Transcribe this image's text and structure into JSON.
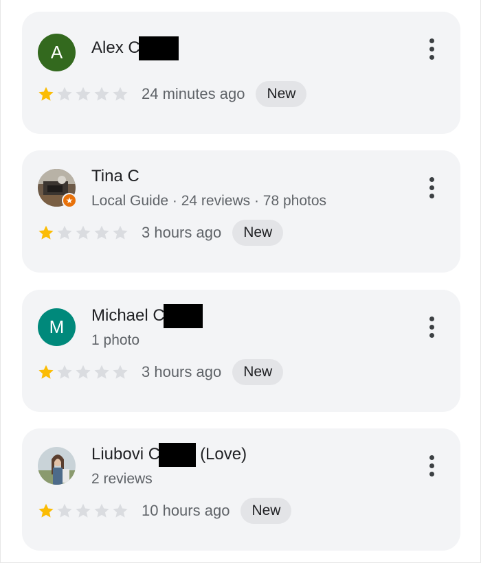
{
  "reviews": [
    {
      "avatar_letter": "A",
      "avatar_color": "#33691e",
      "name": "Alex C",
      "name_suffix": "",
      "meta": "",
      "rating": 1,
      "max_rating": 5,
      "time": "24 minutes ago",
      "badge": "New"
    },
    {
      "avatar_letter": "",
      "avatar_color": "",
      "name": "Tina C",
      "name_suffix": "",
      "meta": "Local Guide · 24 reviews · 78 photos",
      "rating": 1,
      "max_rating": 5,
      "time": "3 hours ago",
      "badge": "New"
    },
    {
      "avatar_letter": "M",
      "avatar_color": "#00897b",
      "name": "Michael C",
      "name_suffix": "",
      "meta": "1 photo",
      "rating": 1,
      "max_rating": 5,
      "time": "3 hours ago",
      "badge": "New"
    },
    {
      "avatar_letter": "",
      "avatar_color": "",
      "name": "Liubovi C",
      "name_suffix": "(Love)",
      "meta": "2 reviews",
      "rating": 1,
      "max_rating": 5,
      "time": "10 hours ago",
      "badge": "New"
    }
  ],
  "colors": {
    "star_filled": "#fbbc04",
    "star_empty": "#dadce0",
    "card_bg": "#f3f4f6",
    "badge_bg": "#e3e4e7"
  },
  "icons": {
    "more": "more-vert-icon",
    "star": "star-icon",
    "guide": "local-guide-star-icon"
  }
}
